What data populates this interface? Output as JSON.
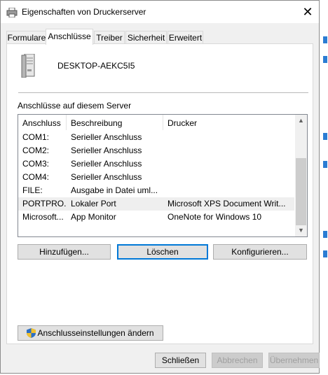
{
  "window": {
    "title": "Eigenschaften von Druckerserver",
    "close_glyph": "✕"
  },
  "tabs": [
    {
      "label": "Formulare",
      "active": false
    },
    {
      "label": "Anschlüsse",
      "active": true
    },
    {
      "label": "Treiber",
      "active": false
    },
    {
      "label": "Sicherheit",
      "active": false
    },
    {
      "label": "Erweitert",
      "active": false
    }
  ],
  "server": {
    "name": "DESKTOP-AEKC5I5",
    "icon": "server-icon"
  },
  "ports_list": {
    "caption": "Anschlüsse auf diesem Server",
    "columns": [
      "Anschluss",
      "Beschreibung",
      "Drucker"
    ],
    "rows": [
      {
        "port": "COM1:",
        "description": "Serieller Anschluss",
        "printer": ""
      },
      {
        "port": "COM2:",
        "description": "Serieller Anschluss",
        "printer": ""
      },
      {
        "port": "COM3:",
        "description": "Serieller Anschluss",
        "printer": ""
      },
      {
        "port": "COM4:",
        "description": "Serieller Anschluss",
        "printer": ""
      },
      {
        "port": "FILE:",
        "description": "Ausgabe in Datei uml...",
        "printer": ""
      },
      {
        "port": "PORTPRO...",
        "description": "Lokaler Port",
        "printer": "Microsoft XPS Document Writ...",
        "selected": true
      },
      {
        "port": "Microsoft...",
        "description": "App Monitor",
        "printer": "OneNote for Windows 10"
      }
    ],
    "scroll_up_glyph": "▲",
    "scroll_down_glyph": "▼"
  },
  "actions": {
    "add": "Hinzufügen...",
    "delete": "Löschen",
    "configure": "Konfigurieren...",
    "change_settings": "Anschlusseinstellungen ändern"
  },
  "footer": {
    "close": "Schließen",
    "cancel": "Abbrechen",
    "apply": "Übernehmen"
  },
  "colors": {
    "accent": "#0078d7",
    "selected_row": "#efefef",
    "dialog_bg": "#f0f0f0"
  }
}
